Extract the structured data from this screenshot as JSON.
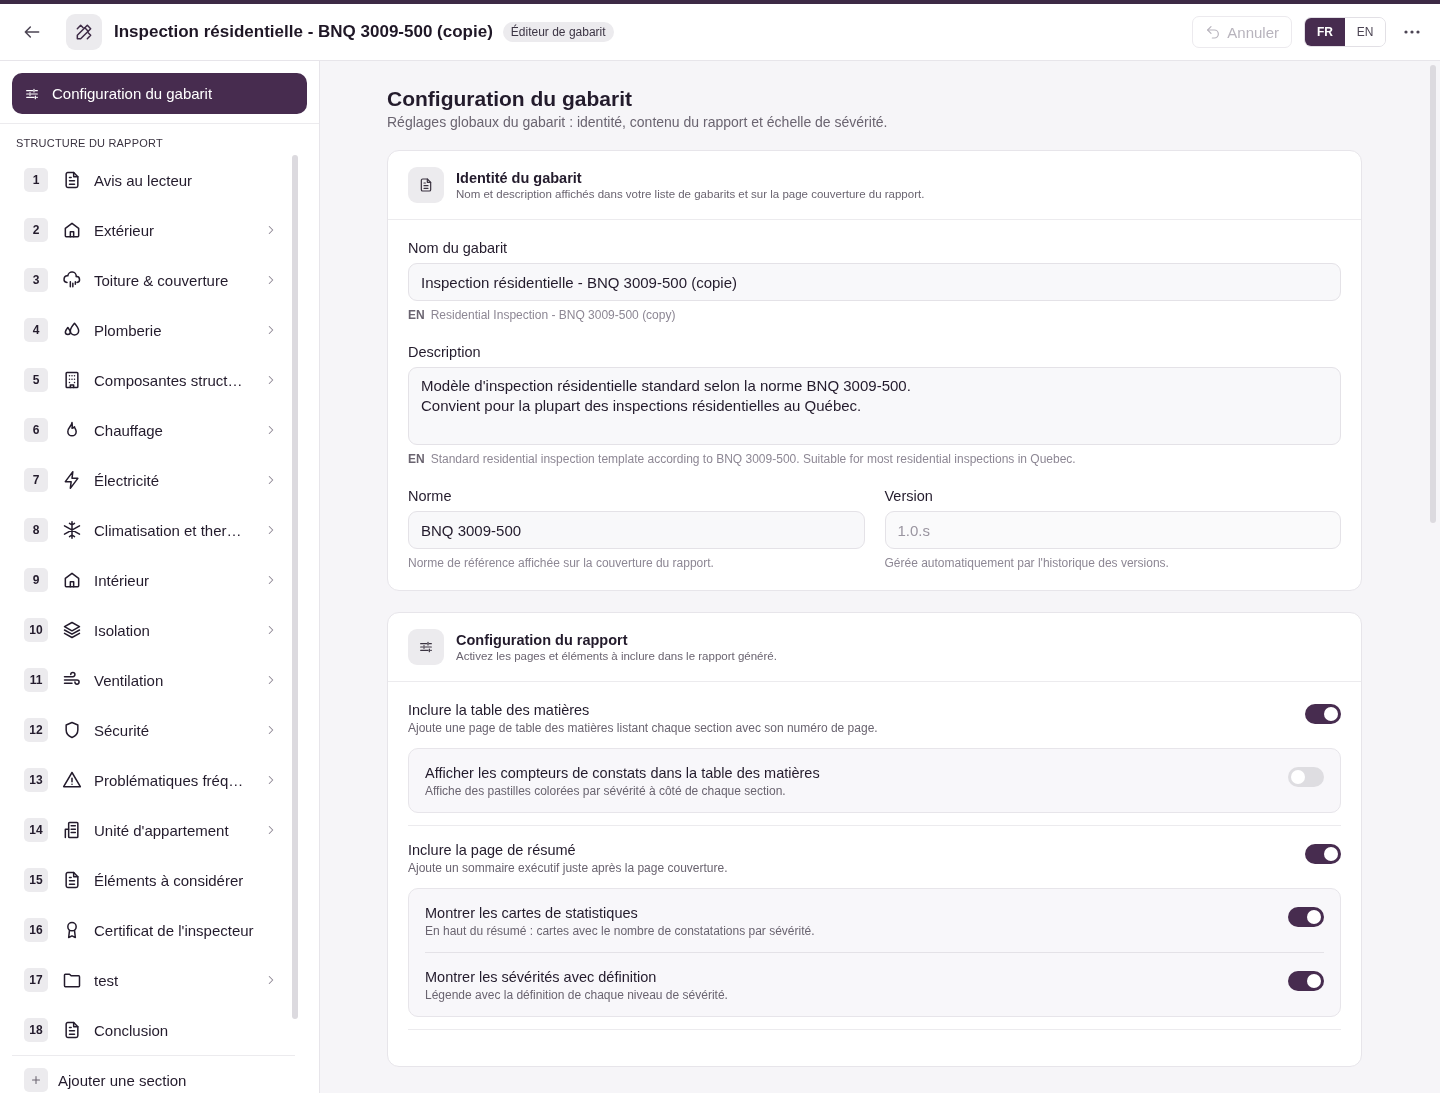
{
  "header": {
    "title": "Inspection résidentielle - BNQ 3009-500 (copie)",
    "badge": "Éditeur de gabarit",
    "undo_button": "Annuler",
    "undo_disabled": true,
    "languages": [
      {
        "label": "FR",
        "selected": true
      },
      {
        "label": "EN",
        "selected": false
      }
    ]
  },
  "sidebar": {
    "config_button": "Configuration du gabarit",
    "config_selected": true,
    "section_heading": "STRUCTURE DU RAPPORT",
    "sections": [
      {
        "number": "1",
        "label": "Avis au lecteur",
        "expandable": false
      },
      {
        "number": "2",
        "label": "Extérieur",
        "expandable": true
      },
      {
        "number": "3",
        "label": "Toiture & couverture",
        "expandable": true
      },
      {
        "number": "4",
        "label": "Plomberie",
        "expandable": true
      },
      {
        "number": "5",
        "label": "Composantes struct…",
        "expandable": true
      },
      {
        "number": "6",
        "label": "Chauffage",
        "expandable": true
      },
      {
        "number": "7",
        "label": "Électricité",
        "expandable": true
      },
      {
        "number": "8",
        "label": "Climatisation et ther…",
        "expandable": true
      },
      {
        "number": "9",
        "label": "Intérieur",
        "expandable": true
      },
      {
        "number": "10",
        "label": "Isolation",
        "expandable": true
      },
      {
        "number": "11",
        "label": "Ventilation",
        "expandable": true
      },
      {
        "number": "12",
        "label": "Sécurité",
        "expandable": true
      },
      {
        "number": "13",
        "label": "Problématiques fréq…",
        "expandable": true
      },
      {
        "number": "14",
        "label": "Unité d'appartement",
        "expandable": true
      },
      {
        "number": "15",
        "label": "Éléments à considérer",
        "expandable": false
      },
      {
        "number": "16",
        "label": "Certificat de l'inspecteur",
        "expandable": false
      },
      {
        "number": "17",
        "label": "test",
        "expandable": true
      },
      {
        "number": "18",
        "label": "Conclusion",
        "expandable": false
      }
    ],
    "add_section": "Ajouter une section"
  },
  "page": {
    "title": "Configuration du gabarit",
    "subtitle": "Réglages globaux du gabarit : identité, contenu du rapport et échelle de sévérité."
  },
  "identity_card": {
    "title": "Identité du gabarit",
    "description": "Nom et description affichés dans votre liste de gabarits et sur la page couverture du rapport.",
    "name_label": "Nom du gabarit",
    "name_value": "Inspection résidentielle - BNQ 3009-500 (copie)",
    "name_en_tag": "EN",
    "name_en": "Residential Inspection - BNQ 3009-500 (copy)",
    "description_label": "Description",
    "description_value": "Modèle d'inspection résidentielle standard selon la norme BNQ 3009-500.\nConvient pour la plupart des inspections résidentielles au Québec.",
    "description_en_tag": "EN",
    "description_en": "Standard residential inspection template according to BNQ 3009-500. Suitable for most residential inspections in Quebec.",
    "norm_label": "Norme",
    "norm_value": "BNQ 3009-500",
    "norm_hint": "Norme de référence affichée sur la couverture du rapport.",
    "version_label": "Version",
    "version_value": "1.0.s",
    "version_disabled": true,
    "version_hint": "Gérée automatiquement par l'historique des versions."
  },
  "report_card": {
    "title": "Configuration du rapport",
    "description": "Activez les pages et éléments à inclure dans le rapport généré.",
    "options": [
      {
        "label": "Inclure la table des matières",
        "description": "Ajoute une page de table des matières listant chaque section avec son numéro de page.",
        "on": true,
        "children": [
          {
            "label": "Afficher les compteurs de constats dans la table des matières",
            "description": "Affiche des pastilles colorées par sévérité à côté de chaque section.",
            "on": false
          }
        ]
      },
      {
        "label": "Inclure la page de résumé",
        "description": "Ajoute un sommaire exécutif juste après la page couverture.",
        "on": true,
        "children": [
          {
            "label": "Montrer les cartes de statistiques",
            "description": "En haut du résumé : cartes avec le nombre de constatations par sévérité.",
            "on": true
          },
          {
            "label": "Montrer les sévérités avec définition",
            "description": "Légende avec la définition de chaque niveau de sévérité.",
            "on": true
          }
        ]
      }
    ]
  }
}
